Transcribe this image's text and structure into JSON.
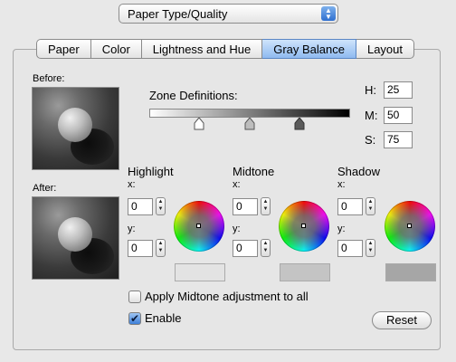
{
  "popup": {
    "value": "Paper Type/Quality"
  },
  "tabs": [
    {
      "label": "Paper"
    },
    {
      "label": "Color"
    },
    {
      "label": "Lightness and Hue"
    },
    {
      "label": "Gray Balance",
      "active": true
    },
    {
      "label": "Layout"
    }
  ],
  "before_label": "Before:",
  "after_label": "After:",
  "zone": {
    "label": "Zone Definitions:",
    "h_label": "H:",
    "h_value": "25",
    "m_label": "M:",
    "m_value": "50",
    "s_label": "S:",
    "s_value": "75"
  },
  "groups": [
    {
      "title": "Highlight",
      "x_label": "x:",
      "x_value": "0",
      "y_label": "y:",
      "y_value": "0"
    },
    {
      "title": "Midtone",
      "x_label": "x:",
      "x_value": "0",
      "y_label": "y:",
      "y_value": "0"
    },
    {
      "title": "Shadow",
      "x_label": "x:",
      "x_value": "0",
      "y_label": "y:",
      "y_value": "0"
    }
  ],
  "apply_all": {
    "label": "Apply Midtone adjustment to all",
    "checked": false
  },
  "enable": {
    "label": "Enable",
    "checked": true
  },
  "reset_label": "Reset",
  "colors": {
    "selected_tab": "#8fbaf0",
    "checkbox_on": "#3d7fd8"
  }
}
